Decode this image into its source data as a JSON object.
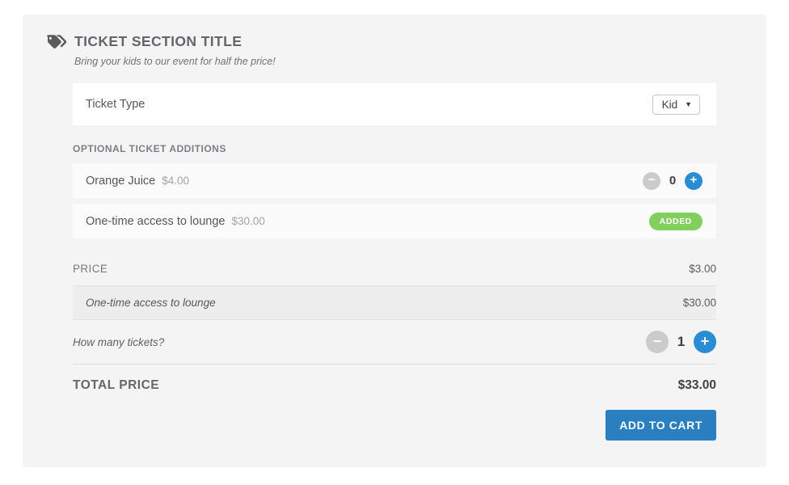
{
  "card": {
    "icon": "price-tag-icon",
    "title": "TICKET SECTION TITLE",
    "subtitle": "Bring your kids to our event for half the price!"
  },
  "ticket_type": {
    "label": "Ticket Type",
    "selected": "Kid",
    "caret": "▼"
  },
  "additions": {
    "heading": "OPTIONAL TICKET ADDITIONS",
    "items": [
      {
        "name": "Orange Juice",
        "price": "$4.00",
        "control": "stepper",
        "quantity": "0",
        "minus": "−",
        "plus": "+"
      },
      {
        "name": "One-time access to lounge",
        "price": "$30.00",
        "control": "badge",
        "badge": "ADDED"
      }
    ]
  },
  "price": {
    "label": "PRICE",
    "value": "$3.00",
    "line_items": [
      {
        "name": "One-time access to lounge",
        "value": "$30.00"
      }
    ]
  },
  "quantity": {
    "label": "How many tickets?",
    "value": "1",
    "minus": "−",
    "plus": "+"
  },
  "total": {
    "label": "TOTAL PRICE",
    "value": "$33.00"
  },
  "actions": {
    "add_to_cart": "ADD TO CART"
  },
  "colors": {
    "card_bg": "#f4f4f4",
    "accent_blue": "#2a8cd2",
    "button_blue": "#2a7fc0",
    "badge_green": "#83cf5d",
    "minus_gray": "#cbcbcb"
  }
}
